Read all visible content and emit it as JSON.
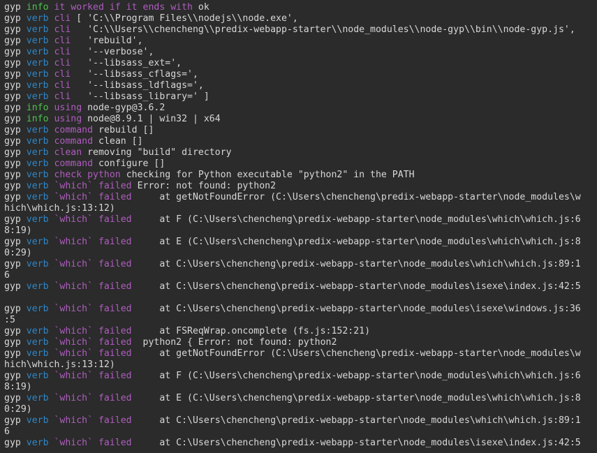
{
  "colors": {
    "background": "#2a2b2a",
    "text": "#d8d8d8",
    "info": "#4ec24e",
    "verb": "#2f86c9",
    "highlight": "#b05cc0"
  },
  "lines": [
    [
      [
        "gyp ",
        "white"
      ],
      [
        "info ",
        "green"
      ],
      [
        "it worked if it ends with ",
        "magenta"
      ],
      [
        "ok",
        "white"
      ]
    ],
    [
      [
        "gyp ",
        "white"
      ],
      [
        "verb ",
        "blue"
      ],
      [
        "cli ",
        "magenta"
      ],
      [
        "[ 'C:\\\\Program Files\\\\nodejs\\\\node.exe',",
        "white"
      ]
    ],
    [
      [
        "gyp ",
        "white"
      ],
      [
        "verb ",
        "blue"
      ],
      [
        "cli ",
        "magenta"
      ],
      [
        "  'C:\\\\Users\\\\chencheng\\\\predix-webapp-starter\\\\node_modules\\\\node-gyp\\\\bin\\\\node-gyp.js',",
        "white"
      ]
    ],
    [
      [
        "gyp ",
        "white"
      ],
      [
        "verb ",
        "blue"
      ],
      [
        "cli ",
        "magenta"
      ],
      [
        "  'rebuild',",
        "white"
      ]
    ],
    [
      [
        "gyp ",
        "white"
      ],
      [
        "verb ",
        "blue"
      ],
      [
        "cli ",
        "magenta"
      ],
      [
        "  '--verbose',",
        "white"
      ]
    ],
    [
      [
        "gyp ",
        "white"
      ],
      [
        "verb ",
        "blue"
      ],
      [
        "cli ",
        "magenta"
      ],
      [
        "  '--libsass_ext=',",
        "white"
      ]
    ],
    [
      [
        "gyp ",
        "white"
      ],
      [
        "verb ",
        "blue"
      ],
      [
        "cli ",
        "magenta"
      ],
      [
        "  '--libsass_cflags=',",
        "white"
      ]
    ],
    [
      [
        "gyp ",
        "white"
      ],
      [
        "verb ",
        "blue"
      ],
      [
        "cli ",
        "magenta"
      ],
      [
        "  '--libsass_ldflags=',",
        "white"
      ]
    ],
    [
      [
        "gyp ",
        "white"
      ],
      [
        "verb ",
        "blue"
      ],
      [
        "cli ",
        "magenta"
      ],
      [
        "  '--libsass_library=' ]",
        "white"
      ]
    ],
    [
      [
        "gyp ",
        "white"
      ],
      [
        "info ",
        "green"
      ],
      [
        "using ",
        "magenta"
      ],
      [
        "node-gyp@3.6.2",
        "white"
      ]
    ],
    [
      [
        "gyp ",
        "white"
      ],
      [
        "info ",
        "green"
      ],
      [
        "using ",
        "magenta"
      ],
      [
        "node@8.9.1 | win32 | x64",
        "white"
      ]
    ],
    [
      [
        "gyp ",
        "white"
      ],
      [
        "verb ",
        "blue"
      ],
      [
        "command ",
        "magenta"
      ],
      [
        "rebuild []",
        "white"
      ]
    ],
    [
      [
        "gyp ",
        "white"
      ],
      [
        "verb ",
        "blue"
      ],
      [
        "command ",
        "magenta"
      ],
      [
        "clean []",
        "white"
      ]
    ],
    [
      [
        "gyp ",
        "white"
      ],
      [
        "verb ",
        "blue"
      ],
      [
        "clean ",
        "magenta"
      ],
      [
        "removing \"build\" directory",
        "white"
      ]
    ],
    [
      [
        "gyp ",
        "white"
      ],
      [
        "verb ",
        "blue"
      ],
      [
        "command ",
        "magenta"
      ],
      [
        "configure []",
        "white"
      ]
    ],
    [
      [
        "gyp ",
        "white"
      ],
      [
        "verb ",
        "blue"
      ],
      [
        "check python ",
        "magenta"
      ],
      [
        "checking for Python executable \"python2\" in the PATH",
        "white"
      ]
    ],
    [
      [
        "gyp ",
        "white"
      ],
      [
        "verb ",
        "blue"
      ],
      [
        "`which` failed ",
        "magenta"
      ],
      [
        "Error: not found: python2",
        "white"
      ]
    ],
    [
      [
        "gyp ",
        "white"
      ],
      [
        "verb ",
        "blue"
      ],
      [
        "`which` failed ",
        "magenta"
      ],
      [
        "    at getNotFoundError (C:\\Users\\chencheng\\predix-webapp-starter\\node_modules\\w",
        "white"
      ]
    ],
    [
      [
        "hich\\which.js:13:12)",
        "white"
      ]
    ],
    [
      [
        "gyp ",
        "white"
      ],
      [
        "verb ",
        "blue"
      ],
      [
        "`which` failed ",
        "magenta"
      ],
      [
        "    at F (C:\\Users\\chencheng\\predix-webapp-starter\\node_modules\\which\\which.js:6",
        "white"
      ]
    ],
    [
      [
        "8:19)",
        "white"
      ]
    ],
    [
      [
        "gyp ",
        "white"
      ],
      [
        "verb ",
        "blue"
      ],
      [
        "`which` failed ",
        "magenta"
      ],
      [
        "    at E (C:\\Users\\chencheng\\predix-webapp-starter\\node_modules\\which\\which.js:8",
        "white"
      ]
    ],
    [
      [
        "0:29)",
        "white"
      ]
    ],
    [
      [
        "gyp ",
        "white"
      ],
      [
        "verb ",
        "blue"
      ],
      [
        "`which` failed ",
        "magenta"
      ],
      [
        "    at C:\\Users\\chencheng\\predix-webapp-starter\\node_modules\\which\\which.js:89:1",
        "white"
      ]
    ],
    [
      [
        "6",
        "white"
      ]
    ],
    [
      [
        "gyp ",
        "white"
      ],
      [
        "verb ",
        "blue"
      ],
      [
        "`which` failed ",
        "magenta"
      ],
      [
        "    at C:\\Users\\chencheng\\predix-webapp-starter\\node_modules\\isexe\\index.js:42:5",
        "white"
      ]
    ],
    [
      [
        "",
        "white"
      ]
    ],
    [
      [
        "gyp ",
        "white"
      ],
      [
        "verb ",
        "blue"
      ],
      [
        "`which` failed ",
        "magenta"
      ],
      [
        "    at C:\\Users\\chencheng\\predix-webapp-starter\\node_modules\\isexe\\windows.js:36",
        "white"
      ]
    ],
    [
      [
        ":5",
        "white"
      ]
    ],
    [
      [
        "gyp ",
        "white"
      ],
      [
        "verb ",
        "blue"
      ],
      [
        "`which` failed ",
        "magenta"
      ],
      [
        "    at FSReqWrap.oncomplete (fs.js:152:21)",
        "white"
      ]
    ],
    [
      [
        "gyp ",
        "white"
      ],
      [
        "verb ",
        "blue"
      ],
      [
        "`which` failed ",
        "magenta"
      ],
      [
        " python2 { Error: not found: python2",
        "white"
      ]
    ],
    [
      [
        "gyp ",
        "white"
      ],
      [
        "verb ",
        "blue"
      ],
      [
        "`which` failed ",
        "magenta"
      ],
      [
        "    at getNotFoundError (C:\\Users\\chencheng\\predix-webapp-starter\\node_modules\\w",
        "white"
      ]
    ],
    [
      [
        "hich\\which.js:13:12)",
        "white"
      ]
    ],
    [
      [
        "gyp ",
        "white"
      ],
      [
        "verb ",
        "blue"
      ],
      [
        "`which` failed ",
        "magenta"
      ],
      [
        "    at F (C:\\Users\\chencheng\\predix-webapp-starter\\node_modules\\which\\which.js:6",
        "white"
      ]
    ],
    [
      [
        "8:19)",
        "white"
      ]
    ],
    [
      [
        "gyp ",
        "white"
      ],
      [
        "verb ",
        "blue"
      ],
      [
        "`which` failed ",
        "magenta"
      ],
      [
        "    at E (C:\\Users\\chencheng\\predix-webapp-starter\\node_modules\\which\\which.js:8",
        "white"
      ]
    ],
    [
      [
        "0:29)",
        "white"
      ]
    ],
    [
      [
        "gyp ",
        "white"
      ],
      [
        "verb ",
        "blue"
      ],
      [
        "`which` failed ",
        "magenta"
      ],
      [
        "    at C:\\Users\\chencheng\\predix-webapp-starter\\node_modules\\which\\which.js:89:1",
        "white"
      ]
    ],
    [
      [
        "6",
        "white"
      ]
    ],
    [
      [
        "gyp ",
        "white"
      ],
      [
        "verb ",
        "blue"
      ],
      [
        "`which` failed ",
        "magenta"
      ],
      [
        "    at C:\\Users\\chencheng\\predix-webapp-starter\\node_modules\\isexe\\index.js:42:5",
        "white"
      ]
    ]
  ]
}
